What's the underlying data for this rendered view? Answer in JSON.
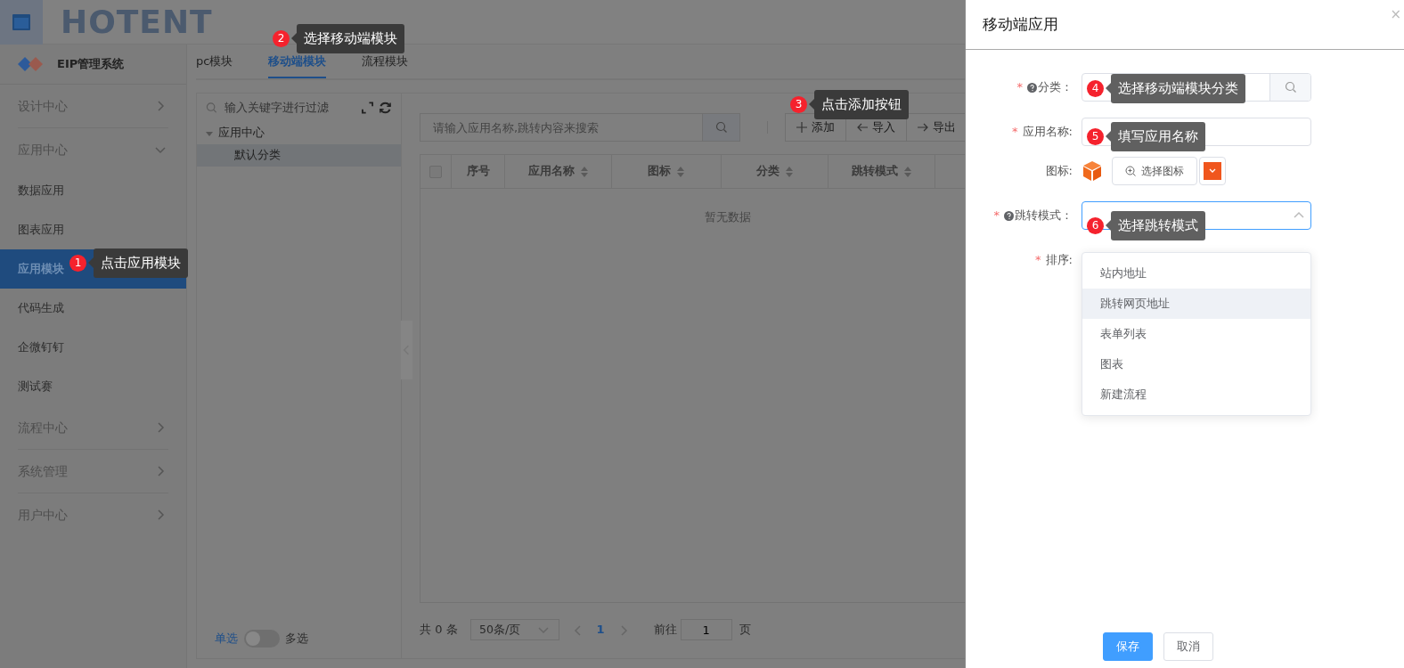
{
  "header": {
    "logo": "HOTENT"
  },
  "sidebar": {
    "system_title": "EIP管理系统",
    "items": [
      {
        "label": "设计中心",
        "kind": "group",
        "expanded": false,
        "selected": false
      },
      {
        "label": "应用中心",
        "kind": "group",
        "expanded": true,
        "selected": false
      },
      {
        "label": "数据应用",
        "kind": "leaf",
        "selected": false
      },
      {
        "label": "图表应用",
        "kind": "leaf",
        "selected": false
      },
      {
        "label": "应用模块",
        "kind": "leaf",
        "selected": true
      },
      {
        "label": "代码生成",
        "kind": "leaf",
        "selected": false
      },
      {
        "label": "企微钉钉",
        "kind": "leaf",
        "selected": false
      },
      {
        "label": "测试赛",
        "kind": "leaf",
        "selected": false
      },
      {
        "label": "流程中心",
        "kind": "group",
        "expanded": false,
        "selected": false
      },
      {
        "label": "系统管理",
        "kind": "group",
        "expanded": false,
        "selected": false
      },
      {
        "label": "用户中心",
        "kind": "group",
        "expanded": false,
        "selected": false
      }
    ]
  },
  "tabs": [
    {
      "label": "pc模块",
      "selected": false
    },
    {
      "label": "移动端模块",
      "selected": true
    },
    {
      "label": "流程模块",
      "selected": false
    }
  ],
  "tree": {
    "filter_placeholder": "输入关键字进行过滤",
    "nodes": [
      {
        "label": "应用中心",
        "expanded": true,
        "selected": false,
        "children": [
          {
            "label": "默认分类",
            "selected": true
          }
        ]
      }
    ]
  },
  "selection_toggle": {
    "left_label": "单选",
    "right_label": "多选",
    "on": false
  },
  "search": {
    "placeholder": "请输入应用名称,跳转内容来搜索"
  },
  "toolbar_buttons": [
    {
      "kind": "plus",
      "label": "添加"
    },
    {
      "kind": "left",
      "label": "导入"
    },
    {
      "kind": "right",
      "label": "导出"
    }
  ],
  "table": {
    "select_all_checked": false,
    "columns": [
      {
        "label": "序号",
        "sortable": false
      },
      {
        "label": "应用名称",
        "sortable": true
      },
      {
        "label": "图标",
        "sortable": true
      },
      {
        "label": "分类",
        "sortable": true
      },
      {
        "label": "跳转模式",
        "sortable": true
      }
    ],
    "empty_text": "暂无数据"
  },
  "pagination": {
    "total": "共 0 条",
    "page_size": "50条/页",
    "pages": [
      {
        "label": "1",
        "selected": true
      }
    ],
    "goto_label": "前往",
    "goto_value": "1",
    "page_suffix": "页"
  },
  "drawer": {
    "title": "移动端应用",
    "close": "×",
    "fields": [
      {
        "label": "分类：",
        "kind": "search",
        "required_mark": "*",
        "help": true,
        "focused": false
      },
      {
        "label": "应用名称:",
        "kind": "input",
        "required_mark": "*",
        "help": false,
        "focused": false
      },
      {
        "label": "图标:",
        "kind": "icon",
        "help": false,
        "button": "选择图标"
      },
      {
        "label": "跳转模式：",
        "kind": "select",
        "required_mark": "*",
        "help": true,
        "focused": true
      },
      {
        "label": "排序:",
        "kind": "hidden",
        "required_mark": "*",
        "help": false
      }
    ],
    "options": [
      {
        "label": "站内地址",
        "hovered": false
      },
      {
        "label": "跳转网页地址",
        "hovered": true
      },
      {
        "label": "表单列表",
        "hovered": false
      },
      {
        "label": "图表",
        "hovered": false
      },
      {
        "label": "新建流程",
        "hovered": false
      }
    ],
    "buttons": [
      {
        "label": "保存",
        "kind": "primary"
      },
      {
        "label": "取消",
        "kind": "default"
      }
    ]
  },
  "annotations": [
    {
      "number": "1",
      "text": "点击应用模块"
    },
    {
      "number": "2",
      "text": "选择移动端模块"
    },
    {
      "number": "3",
      "text": "点击添加按钮"
    },
    {
      "number": "4",
      "text": "选择移动端模块分类"
    },
    {
      "number": "5",
      "text": "填写应用名称"
    },
    {
      "number": "6",
      "text": "选择跳转模式"
    }
  ]
}
